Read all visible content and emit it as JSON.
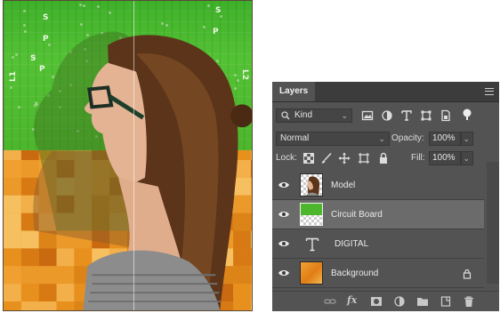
{
  "canvas": {
    "board_labels": [
      {
        "text": "S"
      },
      {
        "text": "P"
      },
      {
        "text": "S"
      },
      {
        "text": "P"
      },
      {
        "text": "L1"
      },
      {
        "text": "L2"
      },
      {
        "text": "P"
      },
      {
        "text": "S"
      }
    ]
  },
  "layers_panel": {
    "tab_title": "Layers",
    "filter": {
      "kind_label": "Kind"
    },
    "blend_mode": "Normal",
    "opacity": {
      "label": "Opacity:",
      "value": "100%"
    },
    "lock": {
      "label": "Lock:"
    },
    "fill": {
      "label": "Fill:",
      "value": "100%"
    },
    "layers": [
      {
        "name": "Model",
        "thumb": "photo",
        "selected": false
      },
      {
        "name": "Circuit Board",
        "thumb": "green",
        "selected": true
      },
      {
        "name": "DIGITAL",
        "thumb": "text",
        "selected": false
      },
      {
        "name": "Background",
        "thumb": "orange",
        "selected": false,
        "locked": true
      }
    ],
    "footer_icons": [
      "link-icon",
      "fx-icon",
      "mask-icon",
      "adjustment-icon",
      "group-icon",
      "new-layer-icon",
      "trash-icon"
    ]
  },
  "colors": {
    "panel_bg": "#535353",
    "selected_row": "#6b6b6b",
    "board_green": "#4cb62c",
    "background_orange": "#e8901e"
  }
}
